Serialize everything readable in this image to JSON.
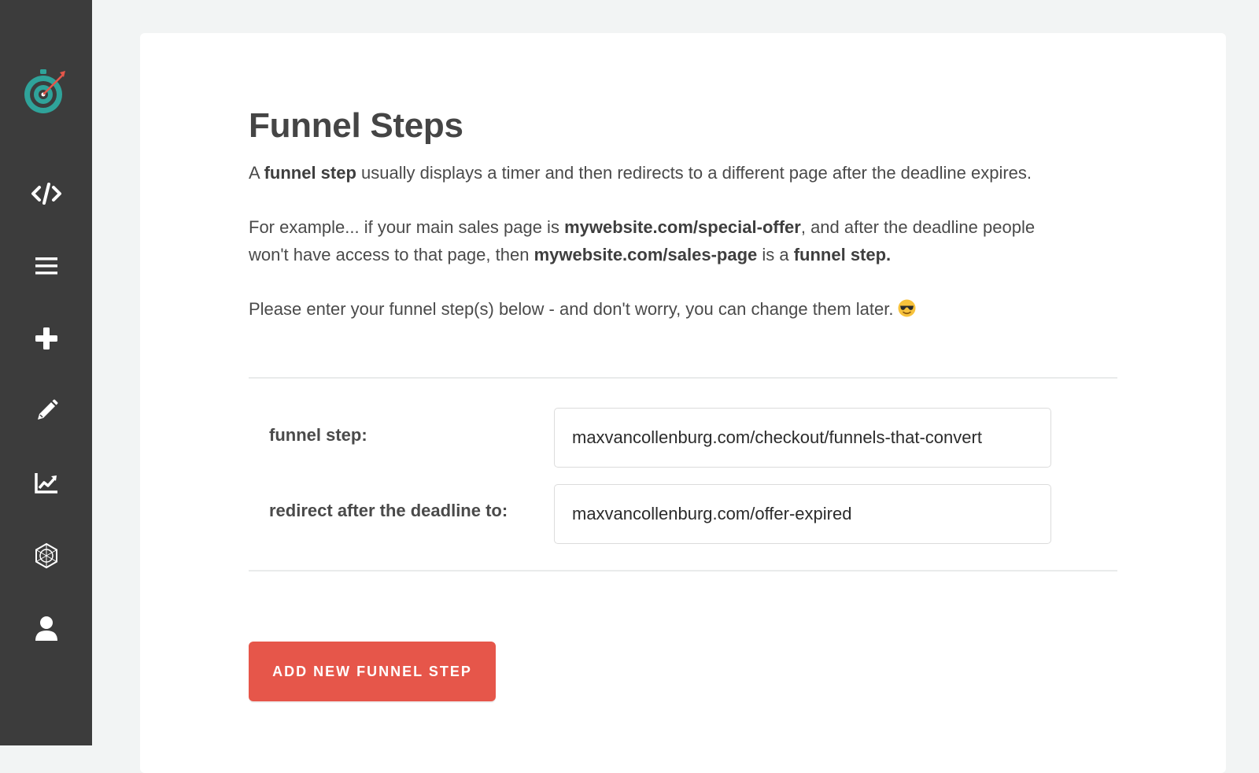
{
  "colors": {
    "sidebar_bg": "#3c3c3c",
    "page_bg": "#f2f4f4",
    "card_bg": "#ffffff",
    "accent_button": "#e6564a",
    "logo_teal": "#2fa39a",
    "logo_red": "#e6564a"
  },
  "sidebar": {
    "logo": "stopwatch-target-logo",
    "items": [
      {
        "icon": "code-icon"
      },
      {
        "icon": "menu-icon"
      },
      {
        "icon": "plus-icon"
      },
      {
        "icon": "pencil-icon"
      },
      {
        "icon": "chart-icon"
      },
      {
        "icon": "integrations-icon"
      },
      {
        "icon": "user-icon"
      }
    ]
  },
  "page": {
    "title": "Funnel Steps",
    "intro": {
      "a": "A ",
      "term": "funnel step",
      "rest": " usually displays a timer and then redirects to a different page after the deadline expires."
    },
    "example": {
      "t1": "For example... if your main sales page is ",
      "url1": "mywebsite.com/special-offer",
      "t2": ", and after the deadline people",
      "t3": "won't have access to that page, then ",
      "url2": "mywebsite.com/sales-page",
      "t4": " is a ",
      "term": "funnel step."
    },
    "prompt": "Please enter your funnel step(s) below - and don't worry, you can change them later.",
    "prompt_emoji": "sunglasses-emoji"
  },
  "form": {
    "funnel_step_label": "funnel step:",
    "funnel_step_value": "maxvancollenburg.com/checkout/funnels-that-convert",
    "redirect_label": "redirect after the deadline to:",
    "redirect_value": "maxvancollenburg.com/offer-expired"
  },
  "actions": {
    "add_step_label": "ADD NEW FUNNEL STEP"
  }
}
